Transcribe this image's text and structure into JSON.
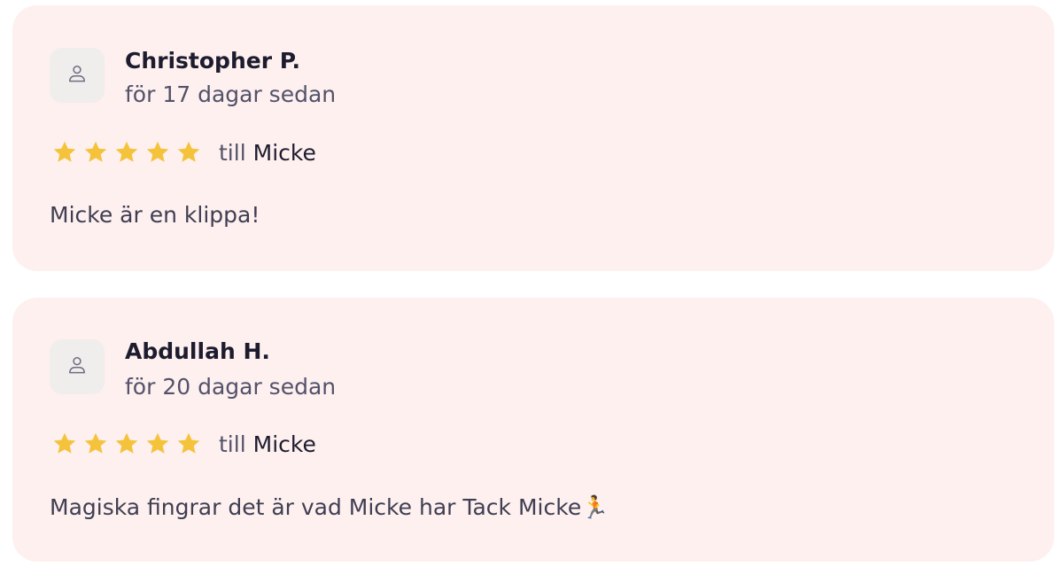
{
  "reviews": [
    {
      "reviewer": "Christopher P.",
      "date": "för 17 dagar sedan",
      "rating": 5,
      "till_label": "till",
      "recipient": "Micke",
      "text": "Micke är en klippa!"
    },
    {
      "reviewer": "Abdullah H.",
      "date": "för 20 dagar sedan",
      "rating": 5,
      "till_label": "till",
      "recipient": "Micke",
      "text": "Magiska fingrar det är vad Micke har Tack Micke🏃"
    }
  ],
  "icons": {
    "avatar": "user-icon",
    "star": "star-icon"
  },
  "colors": {
    "card_background": "#fdf0ef",
    "star": "#f5c33b",
    "avatar_background": "#f0eded"
  }
}
